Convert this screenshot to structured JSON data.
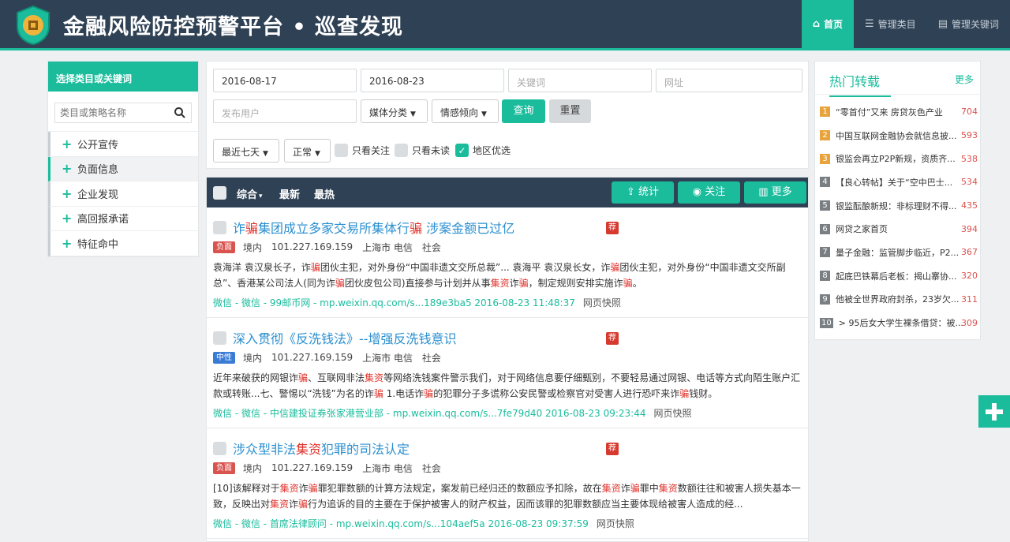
{
  "header": {
    "title": "金融风险防控预警平台 • 巡查发现",
    "nav": [
      {
        "icon": "home-icon",
        "label": "首页",
        "active": true
      },
      {
        "icon": "list-icon",
        "label": "管理类目",
        "active": false
      },
      {
        "icon": "document-icon",
        "label": "管理关键词",
        "active": false
      }
    ]
  },
  "sidebar": {
    "heading": "选择类目或关键词",
    "search_placeholder": "类目或策略名称",
    "items": [
      {
        "label": "公开宣传"
      },
      {
        "label": "负面信息"
      },
      {
        "label": "企业发现"
      },
      {
        "label": "高回报承诺"
      },
      {
        "label": "特征命中"
      }
    ]
  },
  "filters": {
    "date_start": "2016-08-17",
    "date_end": "2016-08-23",
    "keyword_placeholder": "关键词",
    "url_placeholder": "网址",
    "user_placeholder": "发布用户",
    "media_label": "媒体分类",
    "sentiment_label": "情感倾向",
    "search_label": "查询",
    "reset_label": "重置",
    "range_label": "最近七天",
    "status_label": "正常",
    "only_follow": "只看关注",
    "only_unread": "只看未读",
    "region_first": "地区优选"
  },
  "toolbar": {
    "sort_label": "综合",
    "latest_label": "最新",
    "hottest_label": "最热",
    "stats_label": "统计",
    "follow_label": "关注",
    "more_label": "更多"
  },
  "results": [
    {
      "title_parts": [
        "诈",
        "骗",
        "集团成立多家交易所集体行",
        "骗",
        " 涉案金额已过亿"
      ],
      "rec": "荐",
      "sentiment": "负面",
      "scope": "境内",
      "ip": "101.227.169.159",
      "location": "上海市 电信",
      "category": "社会",
      "excerpt_parts": [
        "袁海洋 袁汉泉长子，诈",
        "骗",
        "团伙主犯，对外身份“中国非遗文交所总裁”... 袁海平 袁汉泉长女，诈",
        "骗",
        "团伙主犯，对外身份“中国非遗文交所副总”、香港某公司法人(同为诈",
        "骗",
        "团伙皮包公司)直接参与计划并从事",
        "集资",
        "诈",
        "骗",
        "，制定规则安排实施诈",
        "骗",
        "。"
      ],
      "source": "微信 - 微信 - 99邮币网 - mp.weixin.qq.com/s...189e3ba5  2016-08-23 11:48:37",
      "snapshot": "网页快照"
    },
    {
      "title_parts": [
        "深入贯彻《反洗钱法》--增强反洗钱意识"
      ],
      "rec": "荐",
      "sentiment": "中性",
      "scope": "境内",
      "ip": "101.227.169.159",
      "location": "上海市 电信",
      "category": "社会",
      "excerpt_parts": [
        "近年来破获的网银诈",
        "骗",
        "、互联网非法",
        "集资",
        "等网络洗钱案件警示我们，对于网络信息要仔细甄别，不要轻易通过网银、电话等方式向陌生账户汇款或转账...七、警惕以“洗钱”为名的诈",
        "骗",
        " 1.电话诈",
        "骗",
        "的犯罪分子多谎称公安民警或检察官对受害人进行恐吓来诈",
        "骗",
        "钱财。"
      ],
      "source": "微信 - 微信 - 中信建投证券张家港营业部 - mp.weixin.qq.com/s...7fe79d40  2016-08-23 09:23:44",
      "snapshot": "网页快照"
    },
    {
      "title_parts": [
        "涉众型非法",
        "集资",
        "犯罪的司法认定"
      ],
      "rec": "荐",
      "sentiment": "负面",
      "scope": "境内",
      "ip": "101.227.169.159",
      "location": "上海市 电信",
      "category": "社会",
      "excerpt_parts": [
        "[10]该解释对于",
        "集资",
        "诈",
        "骗",
        "罪犯罪数额的计算方法规定，案发前已经归还的数额应予扣除，故在",
        "集资",
        "诈",
        "骗",
        "罪中",
        "集资",
        "数额往往和被害人损失基本一致，反映出对",
        "集资",
        "诈",
        "骗",
        "行为追诉的目的主要在于保护被害人的财产权益，因而该罪的犯罪数额应当主要体现给被害人造成的经..."
      ],
      "source": "微信 - 微信 - 首席法律顾问 - mp.weixin.qq.com/s...104aef5a  2016-08-23 09:37:59",
      "snapshot": "网页快照"
    }
  ],
  "hot": {
    "title": "热门转载",
    "more": "更多",
    "items": [
      {
        "rank": "1",
        "text": "“零首付”又来 房贷灰色产业",
        "count": "704"
      },
      {
        "rank": "2",
        "text": "中国互联网金融协会就信息披...",
        "count": "593"
      },
      {
        "rank": "3",
        "text": "银监会再立P2P新规，资质齐...",
        "count": "538"
      },
      {
        "rank": "4",
        "text": "【良心转帖】关于“空中巴士...",
        "count": "534"
      },
      {
        "rank": "5",
        "text": "银监酝酿新规：非标理财不得...",
        "count": "435"
      },
      {
        "rank": "6",
        "text": "网贷之家首页",
        "count": "394"
      },
      {
        "rank": "7",
        "text": "量子金融：监管脚步临近，P2...",
        "count": "367"
      },
      {
        "rank": "8",
        "text": "起底巴铁幕后老板：揭山寨协...",
        "count": "320"
      },
      {
        "rank": "9",
        "text": "他被全世界政府封杀，23岁欠...",
        "count": "311"
      },
      {
        "rank": "10",
        "text": "> 95后女大学生裸条借贷：被...",
        "count": "309"
      }
    ]
  },
  "colors": {
    "accent": "#1abc9c",
    "header_bg": "#2f4154",
    "highlight": "#e0332c",
    "link": "#2a8fd0"
  }
}
